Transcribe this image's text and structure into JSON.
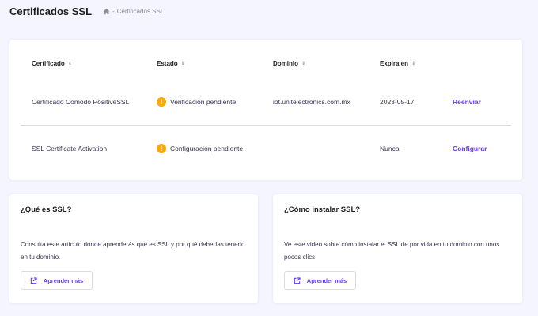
{
  "header": {
    "title": "Certificados SSL",
    "breadcrumb": {
      "separator": "-",
      "current": "Certificados SSL"
    }
  },
  "table": {
    "columns": [
      {
        "label": "Certificado"
      },
      {
        "label": "Estado"
      },
      {
        "label": "Dominio"
      },
      {
        "label": "Expira en"
      }
    ],
    "sort_icon": "⇕",
    "rows": [
      {
        "certificate": "Certificado Comodo PositiveSSL",
        "status": "Verificación pendiente",
        "domain": "iot.unitelectronics.com.mx",
        "expires": "2023-05-17",
        "action": "Reenviar"
      },
      {
        "certificate": "SSL Certificate Activation",
        "status": "Configuración pendiente",
        "domain": "",
        "expires": "Nunca",
        "action": "Configurar"
      }
    ]
  },
  "info_cards": [
    {
      "title": "¿Qué es SSL?",
      "text": "Consulta este artículo donde aprenderás qué es SSL y por qué deberías tenerlo en tu dominio.",
      "button": "Aprender más"
    },
    {
      "title": "¿Cómo instalar SSL?",
      "text": "Ve este video sobre cómo instalar el SSL de por vida en tu dominio con unos pocos clics",
      "button": "Aprender más"
    }
  ],
  "icons": {
    "home": "home-icon",
    "warning": "warning-icon",
    "sort": "sort-icon",
    "external_link": "external-link-icon"
  },
  "colors": {
    "accent": "#673de6",
    "warning": "#ffa800",
    "background": "#f4f5ff"
  }
}
